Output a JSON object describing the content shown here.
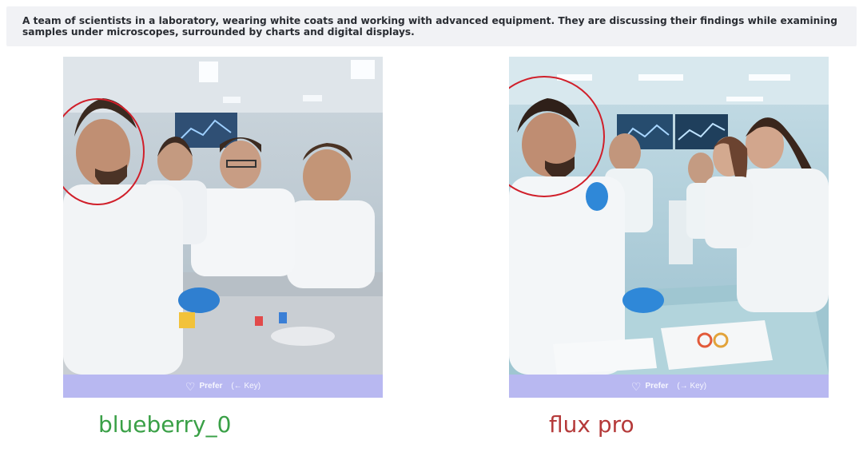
{
  "prompt": {
    "text": "A team of scientists in a laboratory, wearing white coats and working with advanced equipment. They are discussing their findings while examining samples under microscopes, surrounded by charts and digital displays."
  },
  "panels": [
    {
      "model_label": "blueberry_0",
      "model_label_color": "#3aa047",
      "prefer_label": "Prefer",
      "key_hint": "(← Key)"
    },
    {
      "model_label": "flux pro",
      "model_label_color": "#b53a3a",
      "prefer_label": "Prefer",
      "key_hint": "(→ Key)"
    }
  ],
  "colors": {
    "prefer_button_bg": "#b8b8f1",
    "annotation_circle": "#d01f2a",
    "prompt_bg": "#f1f2f5"
  }
}
